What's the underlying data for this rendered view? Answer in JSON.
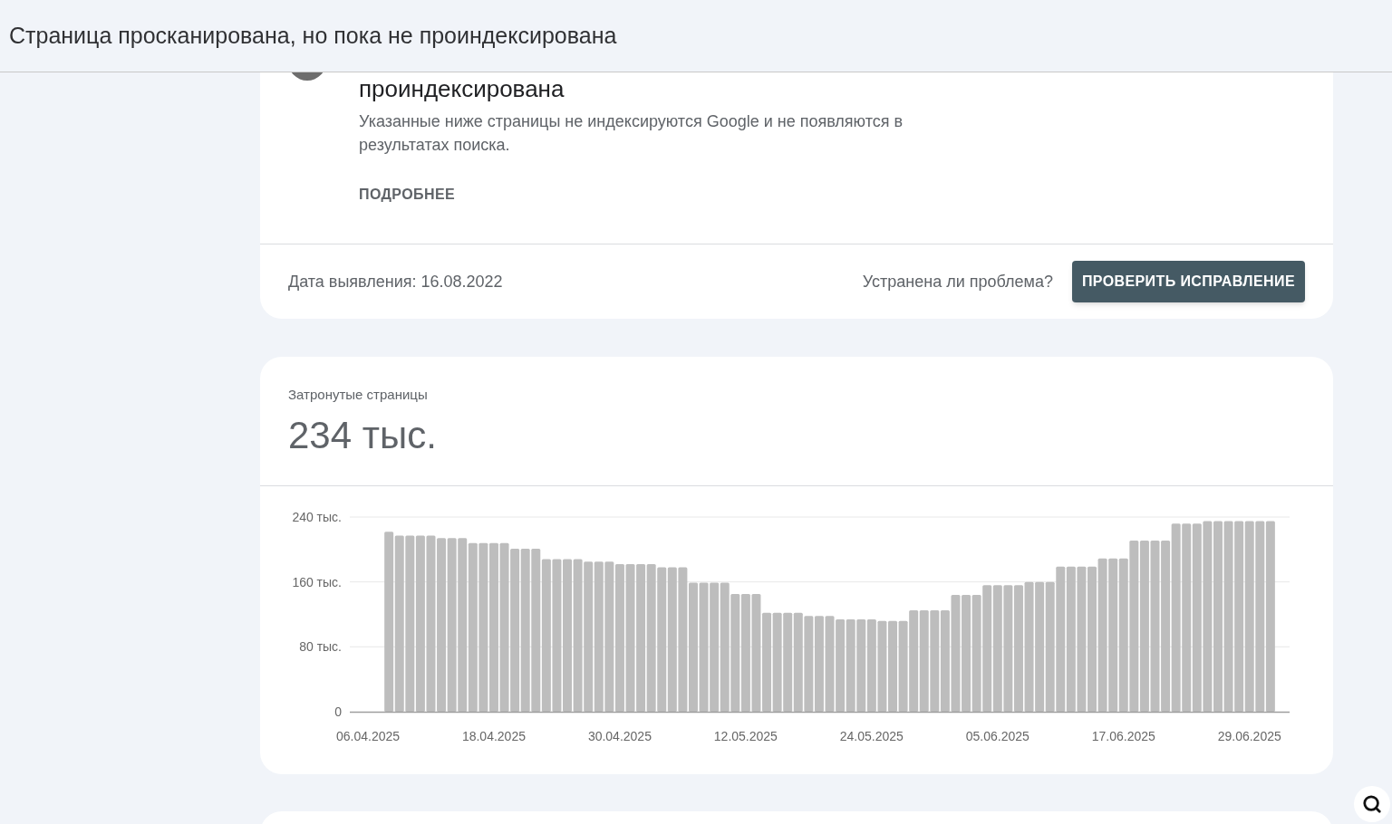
{
  "header": {
    "title": "Страница просканирована, но пока не проиндексирована"
  },
  "issue_card": {
    "title": "проиндексирована",
    "description": "Указанные ниже страницы не индексируются Google и не появляются в результатах поиска.",
    "link": "ПОДРОБНЕЕ",
    "detected": "Дата выявления: 16.08.2022",
    "question": "Устранена ли проблема?",
    "button": "ПРОВЕРИТЬ ИСПРАВЛЕНИЕ"
  },
  "affected_card": {
    "label": "Затронутые страницы",
    "value": "234 тыс.",
    "chart_data": {
      "type": "bar",
      "categories": [
        "06.04.2025",
        null,
        null,
        null,
        null,
        null,
        null,
        null,
        null,
        null,
        null,
        null,
        "18.04.2025",
        null,
        null,
        null,
        null,
        null,
        null,
        null,
        null,
        null,
        null,
        null,
        "30.04.2025",
        null,
        null,
        null,
        null,
        null,
        null,
        null,
        null,
        null,
        null,
        null,
        "12.05.2025",
        null,
        null,
        null,
        null,
        null,
        null,
        null,
        null,
        null,
        null,
        null,
        "24.05.2025",
        null,
        null,
        null,
        null,
        null,
        null,
        null,
        null,
        null,
        null,
        null,
        "05.06.2025",
        null,
        null,
        null,
        null,
        null,
        null,
        null,
        null,
        null,
        null,
        null,
        "17.06.2025",
        null,
        null,
        null,
        null,
        null,
        null,
        null,
        null,
        null,
        null,
        null,
        "29.06.2025",
        null,
        null
      ],
      "values": [
        null,
        null,
        222,
        217,
        217,
        217,
        217,
        214,
        214,
        214,
        208,
        208,
        208,
        208,
        201,
        201,
        201,
        188,
        188,
        188,
        188,
        185,
        185,
        185,
        182,
        182,
        182,
        182,
        178,
        178,
        178,
        159,
        159,
        159,
        159,
        145,
        145,
        145,
        122,
        122,
        122,
        122,
        118,
        118,
        118,
        114,
        114,
        114,
        114,
        112,
        112,
        112,
        125,
        125,
        125,
        125,
        144,
        144,
        144,
        156,
        156,
        156,
        156,
        160,
        160,
        160,
        179,
        179,
        179,
        179,
        189,
        189,
        189,
        211,
        211,
        211,
        211,
        232,
        232,
        232,
        235,
        235,
        235,
        235,
        235,
        235,
        235
      ],
      "ylim": [
        0,
        240
      ],
      "yticks": [
        {
          "value": 0,
          "label": "0"
        },
        {
          "value": 80,
          "label": "80 тыс."
        },
        {
          "value": 160,
          "label": "160 тыс."
        },
        {
          "value": 240,
          "label": "240 тыс."
        }
      ]
    }
  }
}
